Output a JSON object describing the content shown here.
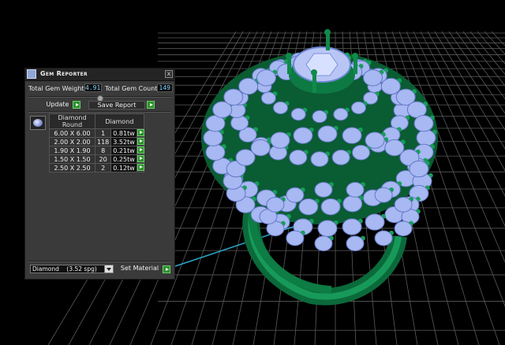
{
  "panel": {
    "title": "Gem Reporter",
    "close_label": "x",
    "total_weight_label": "Total Gem Weight",
    "total_weight_value": "4.91",
    "total_count_label": "Total Gem Count",
    "total_count_value": "149",
    "update_label": "Update",
    "save_report_label": "Save Report",
    "table": {
      "headers": [
        "Diamond Round",
        "Diamond"
      ],
      "rows": [
        {
          "size": "6.00 X 6.00",
          "count": "1",
          "weight": "0.81tw"
        },
        {
          "size": "2.00 X 2.00",
          "count": "118",
          "weight": "3.52tw"
        },
        {
          "size": "1.90 X 1.90",
          "count": "8",
          "weight": "0.21tw"
        },
        {
          "size": "1.50 X 1.50",
          "count": "20",
          "weight": "0.25tw"
        },
        {
          "size": "2.50 X 2.50",
          "count": "2",
          "weight": "0.12tw"
        }
      ]
    },
    "material_value": "Diamond    (3.52 spg)",
    "set_material_label": "Set Material"
  },
  "colors": {
    "ring_metal": "#0f7a44",
    "gem": "#a7b8f2",
    "grid": "#5a5a5a",
    "viewport_bg": "#000000"
  }
}
